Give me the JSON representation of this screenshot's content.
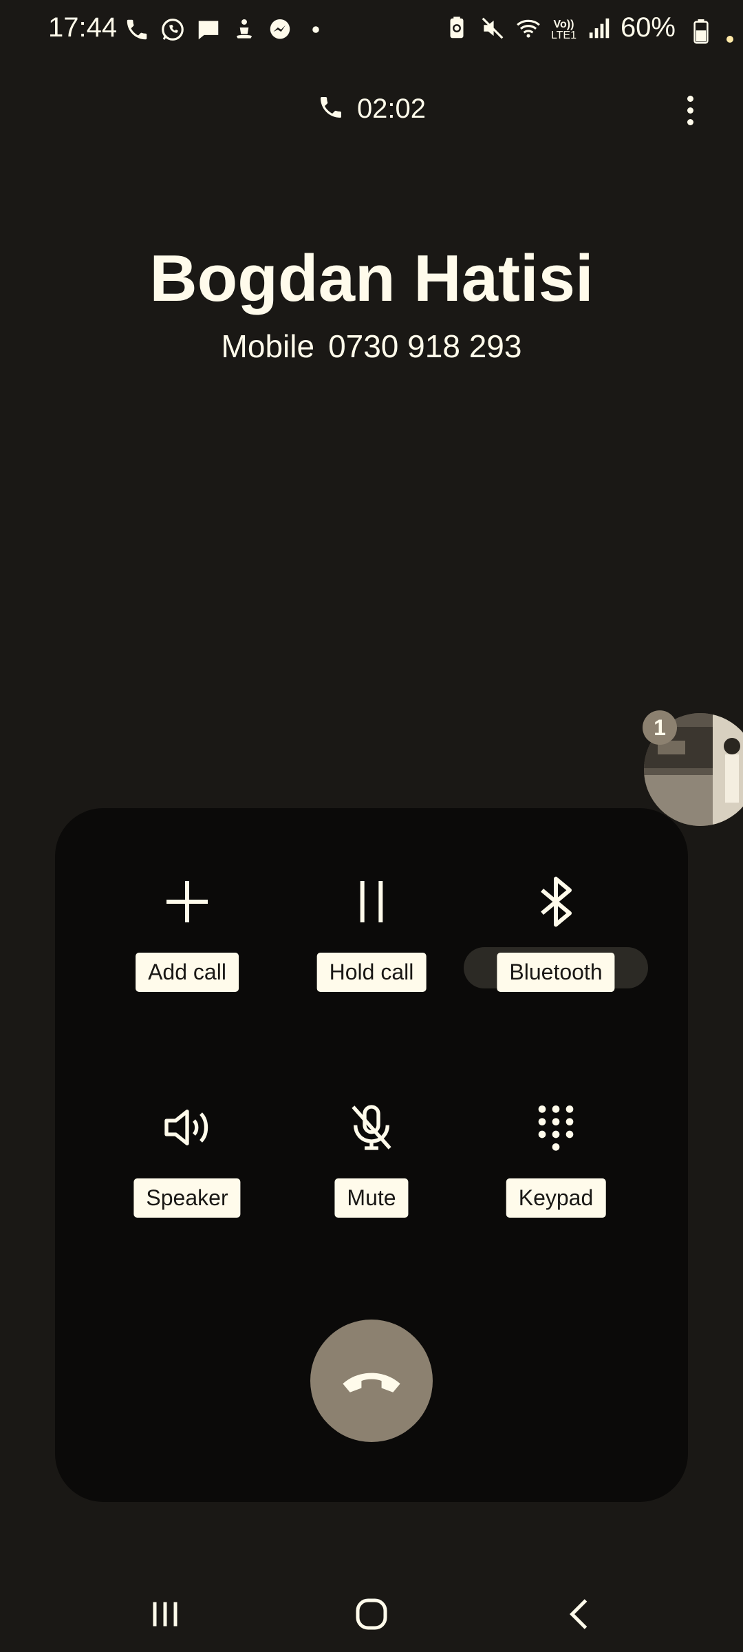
{
  "status_bar": {
    "time": "17:44",
    "battery_percent": "60%",
    "left_icons": [
      "phone-call-icon",
      "whatsapp-icon",
      "message-icon",
      "meditation-app-icon",
      "messenger-icon",
      "notification-dot-icon"
    ],
    "right_icons": [
      "battery-saver-icon",
      "mute-icon",
      "wifi-icon",
      "volte-icon",
      "signal-icon"
    ],
    "volte_label_top": "Vo))",
    "volte_label_bottom": "LTE1"
  },
  "call": {
    "duration": "02:02",
    "contact_name": "Bogdan Hatisi",
    "number_type": "Mobile",
    "number": "0730 918 293"
  },
  "video_bubble": {
    "badge_count": "1"
  },
  "controls": {
    "add_call": "Add call",
    "hold_call": "Hold call",
    "bluetooth": "Bluetooth",
    "speaker": "Speaker",
    "mute": "Mute",
    "keypad": "Keypad"
  },
  "colors": {
    "background": "#1a1815",
    "panel": "#0b0a09",
    "foreground": "#fffbeb",
    "end_call": "#8c8170"
  }
}
